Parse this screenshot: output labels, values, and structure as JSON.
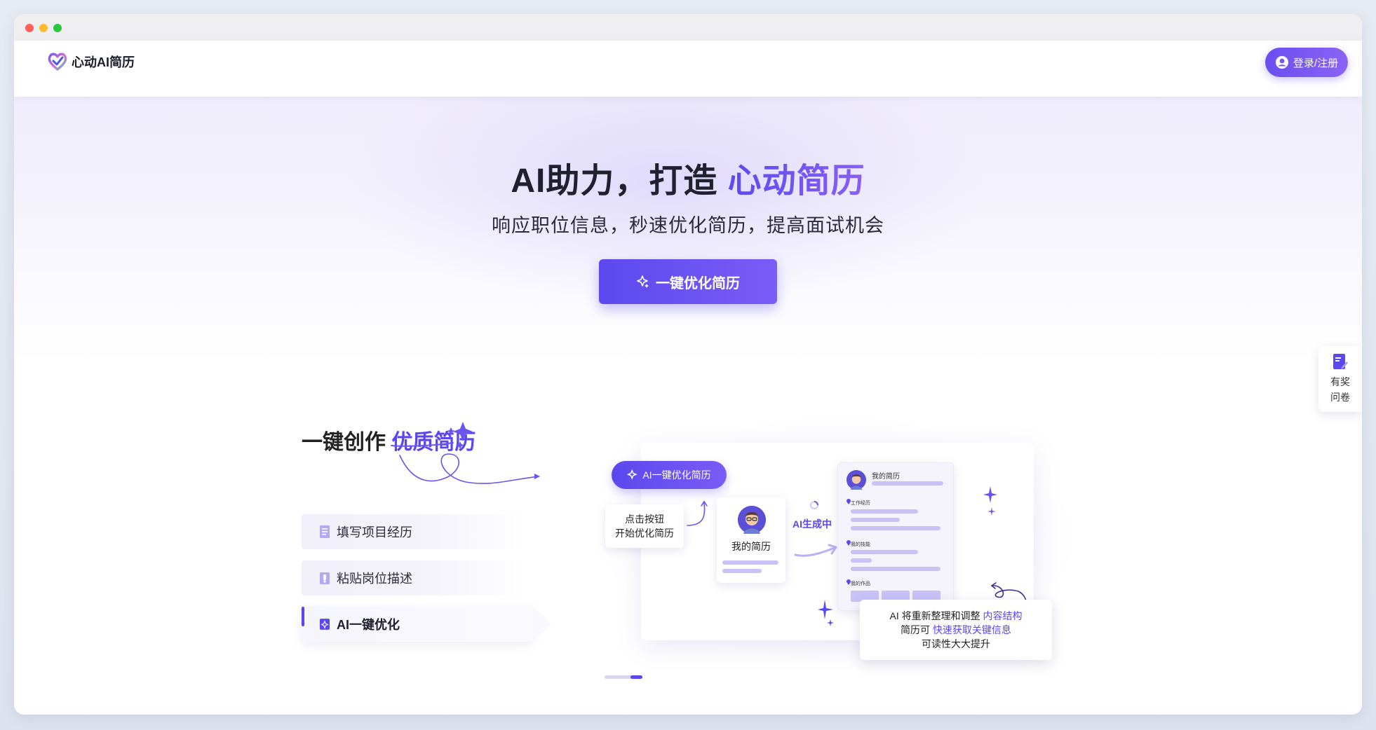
{
  "app": {
    "brand_name": "心动AI简历",
    "login_label": "登录/注册",
    "accent_color": "#5a45ee"
  },
  "hero": {
    "title_main": "AI助力，打造 ",
    "title_accent": "心动简历",
    "subtitle": "响应职位信息，秒速优化简历，提高面试机会",
    "cta_label": "一键优化简历",
    "cta_icon": "sparkle-icon"
  },
  "survey": {
    "label": "有奖问卷",
    "icon": "document-icon"
  },
  "feature": {
    "title_main": "一键创作 ",
    "title_accent": "优质简历",
    "steps": [
      {
        "label": "填写项目经历",
        "icon": "document-icon"
      },
      {
        "label": "粘贴岗位描述",
        "icon": "clipboard-icon"
      },
      {
        "label": "AI一键优化",
        "icon": "sparkle-icon"
      }
    ],
    "active_step": 2
  },
  "illustration": {
    "pill_label": "AI一键优化简历",
    "note_line1": "点击按钮",
    "note_line2": "开始优化简历",
    "my_resume_label": "我的简历",
    "generating_label": "AI生成中",
    "resume_title": "我的简历",
    "resume_sections": [
      "工作经历",
      "我的技能",
      "我的作品"
    ],
    "tip_line1_pre": "AI 将重新整理和调整 ",
    "tip_line1_hl": "内容结构",
    "tip_line2_pre": "简历可 ",
    "tip_line2_hl": "快速获取关键信息",
    "tip_line3": "可读性大大提升"
  },
  "pager": {
    "total": 2,
    "active": 2
  }
}
